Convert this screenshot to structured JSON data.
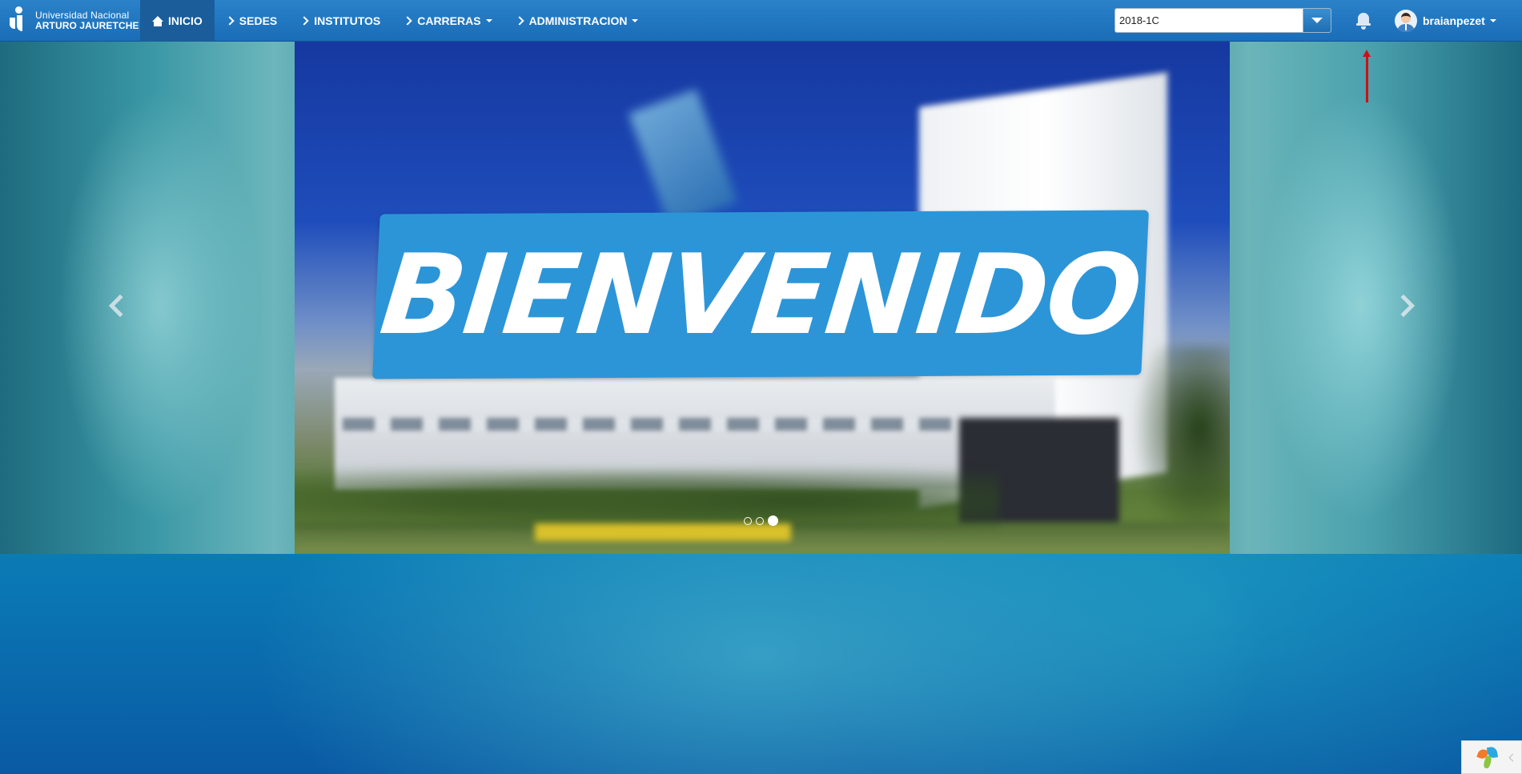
{
  "brand": {
    "line1": "Universidad Nacional",
    "line2": "ARTURO JAURETCHE"
  },
  "nav": {
    "items": [
      {
        "label": "INICIO",
        "icon": "home-icon",
        "active": true,
        "dropdown": false
      },
      {
        "label": "SEDES",
        "icon": "chevron-right-icon",
        "active": false,
        "dropdown": false
      },
      {
        "label": "INSTITUTOS",
        "icon": "chevron-right-icon",
        "active": false,
        "dropdown": false
      },
      {
        "label": "CARRERAS",
        "icon": "chevron-right-icon",
        "active": false,
        "dropdown": true
      },
      {
        "label": "ADMINISTRACION",
        "icon": "chevron-right-icon",
        "active": false,
        "dropdown": true
      }
    ]
  },
  "period_select": {
    "value": "2018-1C"
  },
  "notifications": {
    "icon": "bell-icon"
  },
  "user": {
    "name": "braianpezet"
  },
  "carousel": {
    "banner_text": "BIENVENIDO",
    "slide_count": 3,
    "active_index": 2
  },
  "colors": {
    "navbar": "#1f74bd",
    "banner": "#2c95d8",
    "annotation_arrow": "#d01010"
  }
}
